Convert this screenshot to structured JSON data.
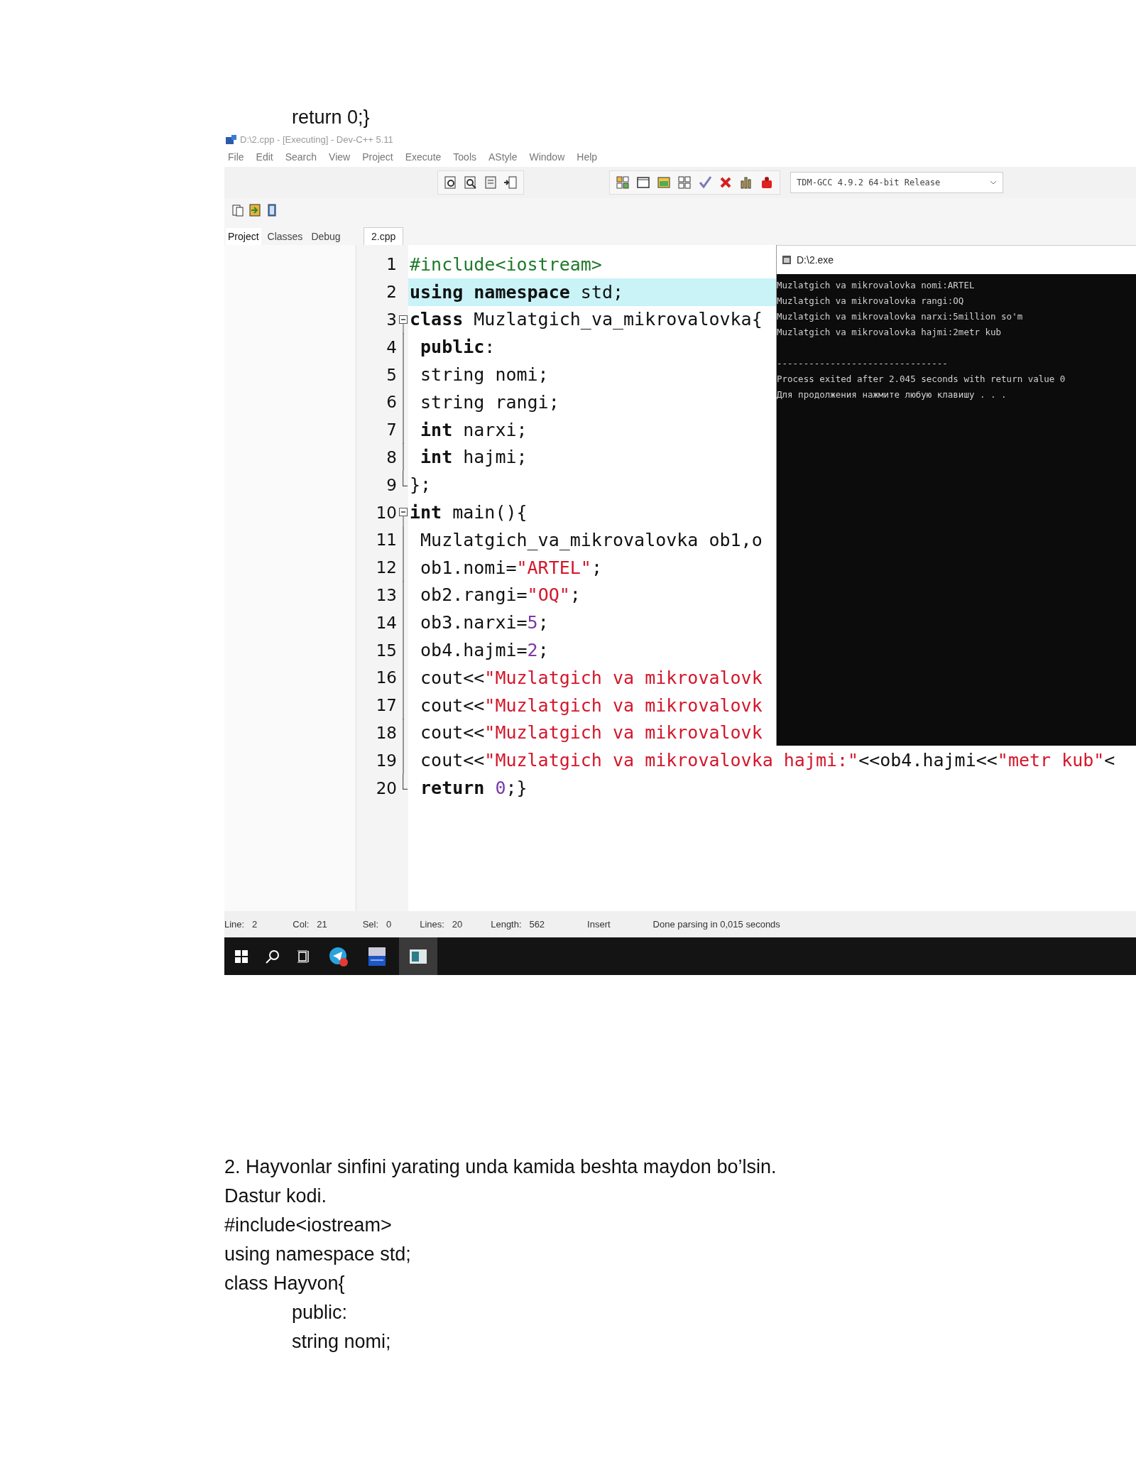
{
  "doc_top": [
    {
      "text": "return 0;}",
      "indented": true
    }
  ],
  "ide": {
    "title": "D:\\2.cpp - [Executing] - Dev-C++ 5.11",
    "menu": [
      "File",
      "Edit",
      "Search",
      "View",
      "Project",
      "Execute",
      "Tools",
      "AStyle",
      "Window",
      "Help"
    ],
    "compiler": "TDM-GCC 4.9.2 64-bit Release",
    "panel_tabs": [
      {
        "label": "Project",
        "selected": true
      },
      {
        "label": "Classes",
        "selected": false
      },
      {
        "label": "Debug",
        "selected": false
      }
    ],
    "editor_tabs": [
      {
        "label": "2.cpp",
        "selected": true
      }
    ],
    "code_lines": [
      {
        "number": "1",
        "kind": "plain",
        "highlighted": false,
        "tokens": [
          {
            "kind": "pre",
            "text": "#include<iostream>"
          }
        ]
      },
      {
        "number": "2",
        "kind": "plain",
        "highlighted": true,
        "tokens": [
          {
            "kind": "kw",
            "text": "using namespace"
          },
          {
            "kind": "plain",
            "text": " std;"
          }
        ]
      },
      {
        "number": "3",
        "kind": "foldstart",
        "highlighted": false,
        "tokens": [
          {
            "kind": "kw",
            "text": "class"
          },
          {
            "kind": "plain",
            "text": " Muzlatgich_va_mikrovalovka{"
          }
        ]
      },
      {
        "number": "4",
        "kind": "foldbody",
        "highlighted": false,
        "tokens": [
          {
            "kind": "kw",
            "text": " public"
          },
          {
            "kind": "plain",
            "text": ":"
          }
        ]
      },
      {
        "number": "5",
        "kind": "foldbody",
        "highlighted": false,
        "tokens": [
          {
            "kind": "plain",
            "text": " string nomi;"
          }
        ]
      },
      {
        "number": "6",
        "kind": "foldbody",
        "highlighted": false,
        "tokens": [
          {
            "kind": "plain",
            "text": " string rangi;"
          }
        ]
      },
      {
        "number": "7",
        "kind": "foldbody",
        "highlighted": false,
        "tokens": [
          {
            "kind": "kw",
            "text": " int"
          },
          {
            "kind": "plain",
            "text": " narxi;"
          }
        ]
      },
      {
        "number": "8",
        "kind": "foldbody",
        "highlighted": false,
        "tokens": [
          {
            "kind": "kw",
            "text": " int"
          },
          {
            "kind": "plain",
            "text": " hajmi;"
          }
        ]
      },
      {
        "number": "9",
        "kind": "foldend",
        "highlighted": false,
        "tokens": [
          {
            "kind": "plain",
            "text": "};"
          }
        ]
      },
      {
        "number": "10",
        "kind": "foldstart",
        "highlighted": false,
        "tokens": [
          {
            "kind": "kw",
            "text": "int"
          },
          {
            "kind": "plain",
            "text": " main(){"
          }
        ]
      },
      {
        "number": "11",
        "kind": "foldbody",
        "highlighted": false,
        "tokens": [
          {
            "kind": "plain",
            "text": " Muzlatgich_va_mikrovalovka ob1,o"
          }
        ]
      },
      {
        "number": "12",
        "kind": "foldbody",
        "highlighted": false,
        "tokens": [
          {
            "kind": "plain",
            "text": " ob1.nomi="
          },
          {
            "kind": "str",
            "text": "\"ARTEL\""
          },
          {
            "kind": "plain",
            "text": ";"
          }
        ]
      },
      {
        "number": "13",
        "kind": "foldbody",
        "highlighted": false,
        "tokens": [
          {
            "kind": "plain",
            "text": " ob2.rangi="
          },
          {
            "kind": "str",
            "text": "\"OQ\""
          },
          {
            "kind": "plain",
            "text": ";"
          }
        ]
      },
      {
        "number": "14",
        "kind": "foldbody",
        "highlighted": false,
        "tokens": [
          {
            "kind": "plain",
            "text": " ob3.narxi="
          },
          {
            "kind": "num",
            "text": "5"
          },
          {
            "kind": "plain",
            "text": ";"
          }
        ]
      },
      {
        "number": "15",
        "kind": "foldbody",
        "highlighted": false,
        "tokens": [
          {
            "kind": "plain",
            "text": " ob4.hajmi="
          },
          {
            "kind": "num",
            "text": "2"
          },
          {
            "kind": "plain",
            "text": ";"
          }
        ]
      },
      {
        "number": "16",
        "kind": "foldbody",
        "highlighted": false,
        "tokens": [
          {
            "kind": "plain",
            "text": " cout<<"
          },
          {
            "kind": "str",
            "text": "\"Muzlatgich va mikrovalovk"
          }
        ]
      },
      {
        "number": "17",
        "kind": "foldbody",
        "highlighted": false,
        "tokens": [
          {
            "kind": "plain",
            "text": " cout<<"
          },
          {
            "kind": "str",
            "text": "\"Muzlatgich va mikrovalovk"
          }
        ]
      },
      {
        "number": "18",
        "kind": "foldbody",
        "highlighted": false,
        "tokens": [
          {
            "kind": "plain",
            "text": " cout<<"
          },
          {
            "kind": "str",
            "text": "\"Muzlatgich va mikrovalovk"
          }
        ]
      },
      {
        "number": "19",
        "kind": "foldbody",
        "highlighted": false,
        "tokens": [
          {
            "kind": "plain",
            "text": " cout<<"
          },
          {
            "kind": "str",
            "text": "\"Muzlatgich va mikrovalovka hajmi:\""
          },
          {
            "kind": "plain",
            "text": "<<ob4.hajmi<<"
          },
          {
            "kind": "str",
            "text": "\"metr kub\""
          },
          {
            "kind": "plain",
            "text": "<"
          }
        ]
      },
      {
        "number": "20",
        "kind": "foldend",
        "highlighted": false,
        "tokens": [
          {
            "kind": "kw",
            "text": " return"
          },
          {
            "kind": "num",
            "text": " 0"
          },
          {
            "kind": "plain",
            "text": ";}"
          }
        ]
      }
    ],
    "console": {
      "title": "D:\\2.exe",
      "lines": [
        "Muzlatgich va mikrovalovka nomi:ARTEL",
        "Muzlatgich va mikrovalovka rangi:OQ",
        "Muzlatgich va mikrovalovka narxi:5million so'm",
        "Muzlatgich va mikrovalovka hajmi:2metr kub",
        "--------------------------------",
        "Process exited after 2.045 seconds with return value 0",
        "Для продолжения нажмите любую клавишу . . ."
      ]
    },
    "status_bar": [
      {
        "label": "Line:",
        "value": "2"
      },
      {
        "label": "Col:",
        "value": "21"
      },
      {
        "label": "Sel:",
        "value": "0"
      },
      {
        "label": "Lines:",
        "value": "20"
      },
      {
        "label": "Length:",
        "value": "562"
      },
      {
        "label": "Insert"
      },
      {
        "label": "Done parsing in 0,015 seconds"
      }
    ]
  },
  "doc_bottom": [
    {
      "text": "2. Hayvonlar sinfini yarating unda kamida beshta maydon bo’lsin.",
      "indented": false
    },
    {
      "text": "Dastur kodi.",
      "indented": false
    },
    {
      "text": "#include<iostream>",
      "indented": false
    },
    {
      "text": "using namespace std;",
      "indented": false
    },
    {
      "text": "class Hayvon{",
      "indented": false
    },
    {
      "text": "public:",
      "indented": true
    },
    {
      "text": "string nomi;",
      "indented": true
    }
  ]
}
